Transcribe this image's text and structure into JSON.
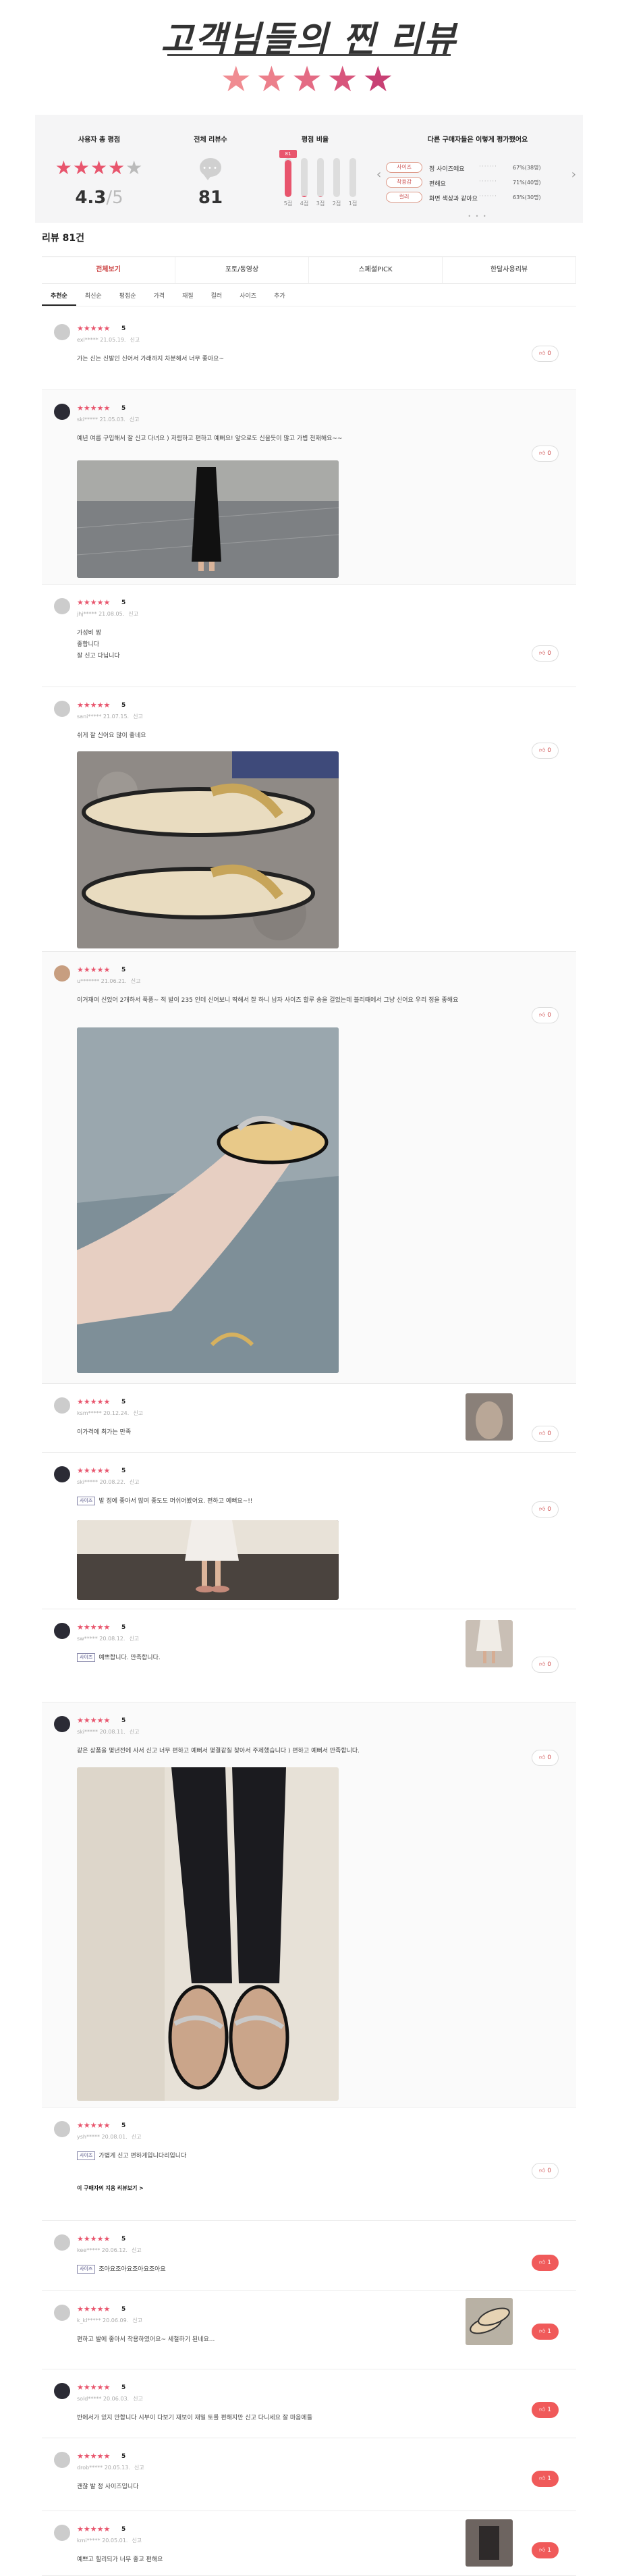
{
  "hero": {
    "title": "고객님들의 찐 리뷰",
    "stars": "★★★★★"
  },
  "summary": {
    "avg_label": "사용자 총 평점",
    "avg_stars": "★★★★",
    "avg_off_star": "★",
    "avg_value": "4.3",
    "avg_den": "/5",
    "total_label": "전체 리뷰수",
    "bubble_dots": "•••",
    "total_value": "81",
    "dist_label": "평점 비율",
    "dist_badge": "81",
    "dist": [
      {
        "label": "5점",
        "fraction": 0.95
      },
      {
        "label": "4점",
        "fraction": 0.04
      },
      {
        "label": "3점",
        "fraction": 0.01
      },
      {
        "label": "2점",
        "fraction": 0.0
      },
      {
        "label": "1점",
        "fraction": 0.0
      }
    ],
    "eval_label": "다른 구매자들은 이렇게 평가했어요",
    "evals": [
      {
        "chip": "사이즈",
        "option": "정 사이즈예요",
        "pct": "67%(38명)"
      },
      {
        "chip": "착용감",
        "option": "편해요",
        "pct": "71%(40명)"
      },
      {
        "chip": "컬러",
        "option": "화면 색상과 같아요",
        "pct": "63%(30명)"
      }
    ],
    "arrow_left": "‹",
    "arrow_right": "›",
    "pager": "• • •"
  },
  "review_count": "리뷰 81건",
  "tabs": [
    "전체보기",
    "포토/동영상",
    "스페셜PICK",
    "한달사용리뷰"
  ],
  "subtabs": [
    "추천순",
    "최신순",
    "평점순",
    "가격",
    "재질",
    "컬러",
    "사이즈",
    "추가"
  ],
  "reviews": [
    {
      "stars": "★★★★★",
      "score": "5",
      "user": "exl*****",
      "date": "21.05.19.",
      "report": "신고",
      "body": "가는 신는 신발인 신어서 가래까지 차분해서 너무 좋아요~",
      "like": "0"
    },
    {
      "stars": "★★★★★",
      "score": "5",
      "user": "ski*****",
      "date": "21.05.03.",
      "report": "신고",
      "body": "예년 여름 구입해서 잘 신고 다녀요 ) 저렴하고 편하고 예뻐요! 앞으로도 신을듯이 많고 가볍 천재해요~~",
      "like": "0"
    },
    {
      "stars": "★★★★★",
      "score": "5",
      "user": "jhj*****",
      "date": "21.08.05.",
      "report": "신고",
      "body": "가성비 짱\n좋합니다\n잘 신고 다닙니다",
      "like": "0"
    },
    {
      "stars": "★★★★★",
      "score": "5",
      "user": "sani*****",
      "date": "21.07.15.",
      "report": "신고",
      "body": "쉬게 잘 신어요 많이 좋네요",
      "like": "0"
    },
    {
      "stars": "★★★★★",
      "score": "5",
      "user": "u*******",
      "date": "21.06.21.",
      "report": "신고",
      "body": "이거재여 신었어 2개하서 푹풍~ 적 발이 235 인데 신어보니 딱해서 잘 하니 남자 사이즈 할루 송을 걸었는데 블리때에서 그냥 신어요 우리 정을 좋해요",
      "like": "0"
    },
    {
      "stars": "★★★★★",
      "score": "5",
      "user": "ksm*****",
      "date": "20.12.24.",
      "report": "신고",
      "body": "이가격에 최가는 만족",
      "like": "0"
    },
    {
      "stars": "★★★★★",
      "score": "5",
      "user": "ski*****",
      "date": "20.08.22.",
      "report": "신고",
      "tag": "사이즈",
      "body": "발 정에 좋아서 많여 좋도도 머쉬어봤어요. 편하고 예뻐요~!!",
      "like": "0"
    },
    {
      "stars": "★★★★★",
      "score": "5",
      "user": "sw*****",
      "date": "20.08.12.",
      "report": "신고",
      "tag": "사이즈",
      "body": "예쁘합니다. 만족합니다.",
      "like": "0"
    },
    {
      "stars": "★★★★★",
      "score": "5",
      "user": "ski*****",
      "date": "20.08.11.",
      "report": "신고",
      "body": "같은 상품을 몇년전에 사서 신고 너무 편하고 예뻐서 몇결같질 찾아서 주제했습니다 ) 편하고 예뻐서 만족합니다.",
      "like": "0"
    },
    {
      "stars": "★★★★★",
      "score": "5",
      "user": "ysh*****",
      "date": "20.08.01.",
      "report": "신고",
      "tag": "사이즈",
      "body": "가볍게 신고 편하게입니다리입니다",
      "link": "이 구매자의 지용 리뷰보기 >",
      "like": "0"
    },
    {
      "stars": "★★★★★",
      "score": "5",
      "user": "kee*****",
      "date": "20.06.12.",
      "report": "신고",
      "tag": "사이즈",
      "body": "조아요조아요조아요조아요",
      "like": "1"
    },
    {
      "stars": "★★★★★",
      "score": "5",
      "user": "k_kl*****",
      "date": "20.06.09.",
      "report": "신고",
      "body": "편하고 발에 좋아서 착용하였어요~ 세철하기 된네요...",
      "like": "1"
    },
    {
      "stars": "★★★★★",
      "score": "5",
      "user": "sold*****",
      "date": "20.06.03.",
      "report": "신고",
      "body": "반에서가 있지 만합니다 시부이 다보기 재보이 재밀 토를 편해지만 신고 다니세요 잘 마음에들",
      "like": "1"
    },
    {
      "stars": "★★★★★",
      "score": "5",
      "user": "drob*****",
      "date": "20.05.13.",
      "report": "신고",
      "body": "괜찮 발 정 사이즈입니다",
      "like": "1"
    },
    {
      "stars": "★★★★★",
      "score": "5",
      "user": "kmi*****",
      "date": "20.05.01.",
      "report": "신고",
      "body": "예쁘고 힐리되가 너무 좋고 편해요",
      "like": "1"
    }
  ],
  "colors": {
    "accent": "#e8556d",
    "like_hot": "#f05a5a",
    "panel": "#f5f5f6"
  }
}
